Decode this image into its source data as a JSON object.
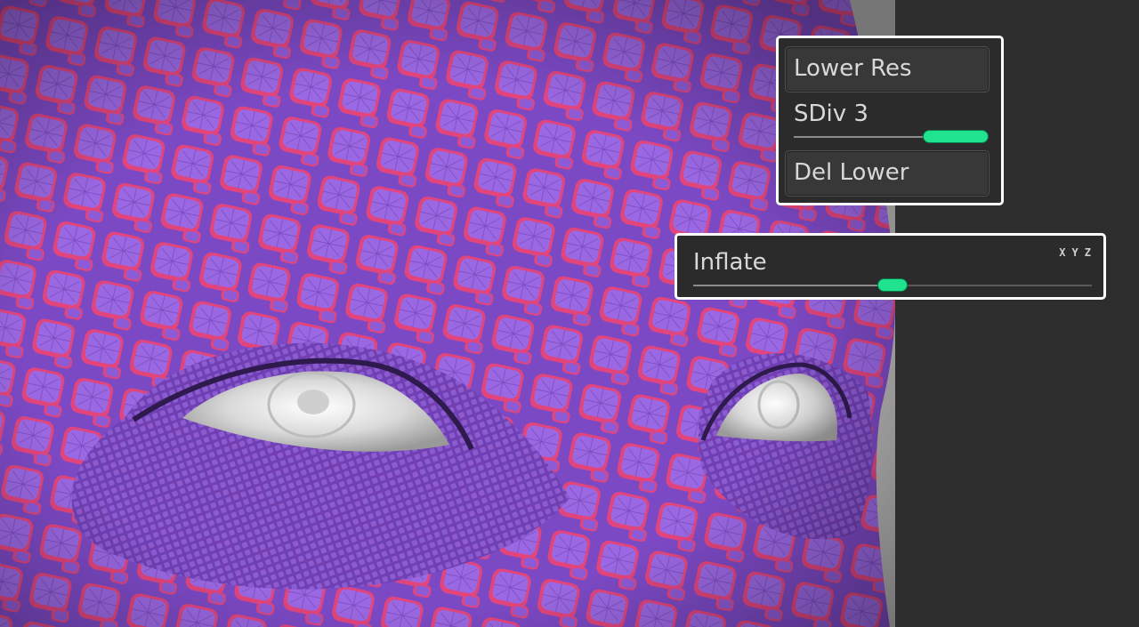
{
  "subdivision": {
    "lower_res_label": "Lower Res",
    "sdiv_label": "SDiv 3",
    "sdiv_value": 3,
    "del_lower_label": "Del Lower"
  },
  "deformation": {
    "inflate_label": "Inflate",
    "inflate_level": 0.5,
    "axes": [
      "X",
      "Y",
      "Z"
    ]
  },
  "colors": {
    "handle": "#1fe38e",
    "panel_border": "#ffffff",
    "mesh_purple": "#8e5bd6",
    "mesh_edge": "#e2457c"
  }
}
